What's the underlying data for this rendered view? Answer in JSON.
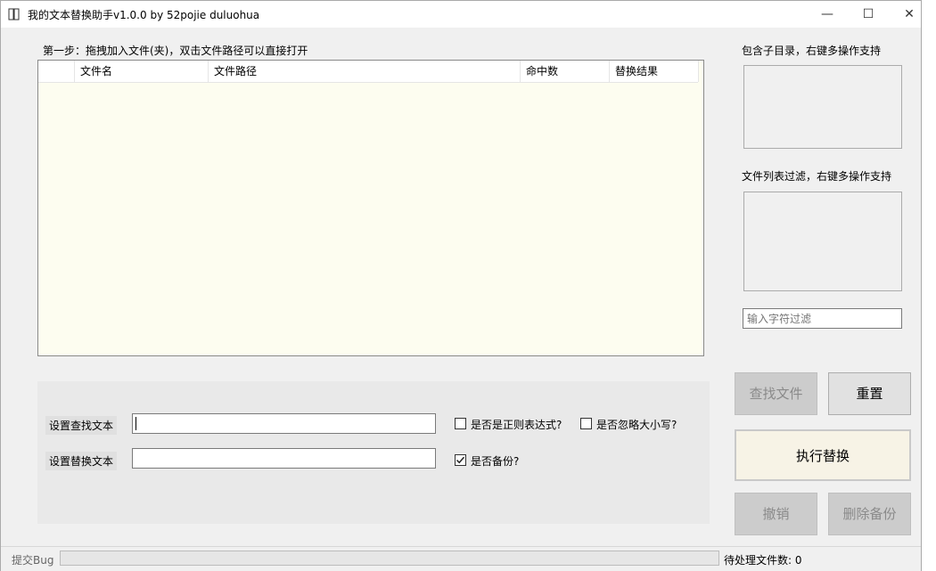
{
  "window": {
    "title": "我的文本替换助手v1.0.0 by 52pojie duluohua",
    "minimize": "—",
    "maximize": "☐",
    "close": "✕"
  },
  "step1": {
    "label": "第一步：拖拽加入文件(夹)，双击文件路径可以直接打开"
  },
  "file_table": {
    "columns": [
      "",
      "文件名",
      "文件路径",
      "命中数",
      "替换结果"
    ],
    "rows": []
  },
  "subdir": {
    "label": "包含子目录，右键多操作支持"
  },
  "filter": {
    "label": "文件列表过滤，右键多操作支持",
    "placeholder": "输入字符过滤"
  },
  "settings": {
    "find_label": "设置查找文本",
    "find_value": "",
    "replace_label": "设置替换文本",
    "replace_value": "",
    "regex_label": "是否是正则表达式?",
    "regex_checked": false,
    "ignore_case_label": "是否忽略大小写?",
    "ignore_case_checked": false,
    "backup_label": "是否备份?",
    "backup_checked": true
  },
  "buttons": {
    "find": "查找文件",
    "reset": "重置",
    "execute": "执行替换",
    "undo": "撤销",
    "delete_backup": "删除备份"
  },
  "statusbar": {
    "bug": "提交Bug",
    "pending": "待处理文件数: 0"
  }
}
